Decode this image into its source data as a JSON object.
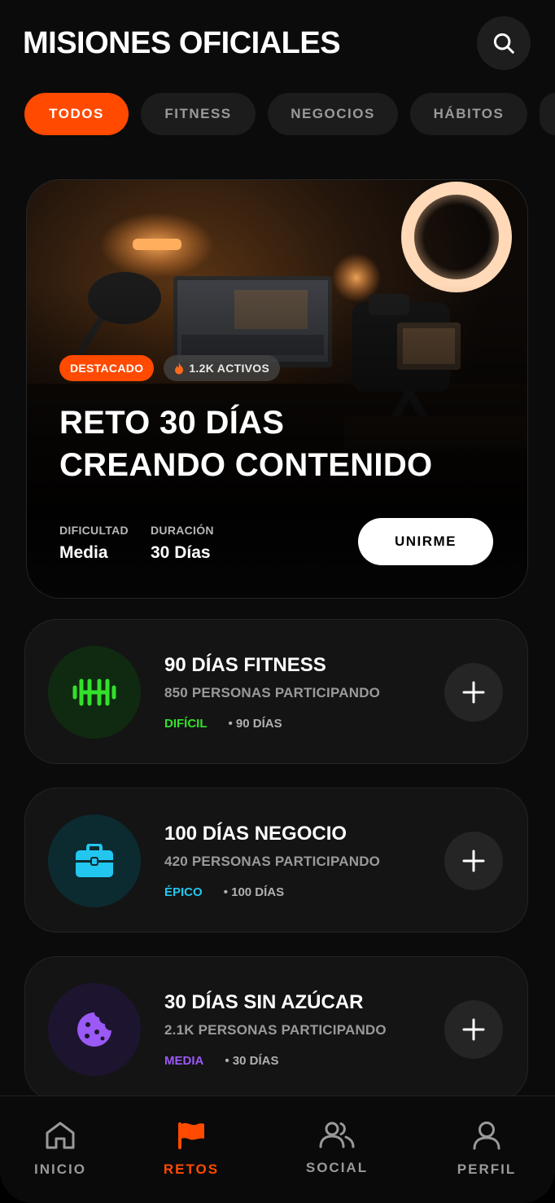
{
  "header": {
    "title": "MISIONES OFICIALES"
  },
  "tabs": [
    {
      "label": "TODOS",
      "active": true
    },
    {
      "label": "FITNESS",
      "active": false
    },
    {
      "label": "NEGOCIOS",
      "active": false
    },
    {
      "label": "HÁBITOS",
      "active": false
    }
  ],
  "featured": {
    "badge": "DESTACADO",
    "active_count": "1.2K ACTIVOS",
    "title_line1": "RETO 30 DÍAS",
    "title_line2": "CREANDO CONTENIDO",
    "difficulty_label": "DIFICULTAD",
    "difficulty_value": "Media",
    "duration_label": "DURACIÓN",
    "duration_value": "30 Días",
    "join_label": "UNIRME"
  },
  "missions": [
    {
      "title": "90 DÍAS FITNESS",
      "participants": "850 PERSONAS PARTICIPANDO",
      "level": "DIFÍCIL",
      "level_color": "#33e02a",
      "days": "• 90 DÍAS",
      "icon": "dumbbell-icon"
    },
    {
      "title": "100 DÍAS NEGOCIO",
      "participants": "420 PERSONAS PARTICIPANDO",
      "level": "ÉPICO",
      "level_color": "#22c6ee",
      "days": "• 100 DÍAS",
      "icon": "briefcase-icon"
    },
    {
      "title": "30 DÍAS SIN AZÚCAR",
      "participants": "2.1K PERSONAS PARTICIPANDO",
      "level": "MEDIA",
      "level_color": "#9b59f5",
      "days": "• 30 DÍAS",
      "icon": "cookie-icon"
    }
  ],
  "nav": [
    {
      "label": "INICIO",
      "icon": "home-icon"
    },
    {
      "label": "RETOS",
      "icon": "flag-icon",
      "active": true
    },
    {
      "label": "SOCIAL",
      "icon": "users-icon"
    },
    {
      "label": "PERFIL",
      "icon": "user-icon"
    }
  ],
  "colors": {
    "accent": "#ff4a00",
    "background": "#0b0b0b",
    "card": "#141414"
  }
}
